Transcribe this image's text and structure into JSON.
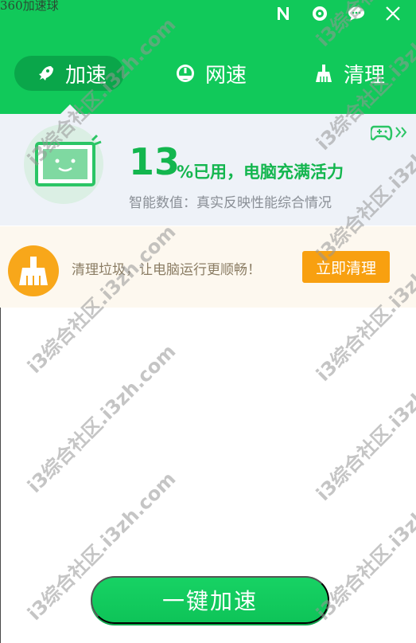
{
  "app": {
    "title": "360加速球"
  },
  "tabs": [
    {
      "label": "加速",
      "icon": "rocket-icon",
      "active": true
    },
    {
      "label": "网速",
      "icon": "speedometer-icon",
      "active": false
    },
    {
      "label": "清理",
      "icon": "broom-icon",
      "active": false
    }
  ],
  "status": {
    "percent": "13",
    "percent_text": "%已用，电脑充满活力",
    "subtitle": "智能数值：真实反映性能综合情况"
  },
  "clean": {
    "message": "清理垃圾，让电脑运行更顺畅！",
    "button": "立即清理"
  },
  "boost": {
    "button": "一键加速"
  },
  "watermarks": [
    "i3综合社区.i3zh.com",
    "i3综合社区.i3zh.com",
    "i3综合社区.i3zh.com",
    "i3综合社区.i3zh.com",
    "i3综合社区.i3zh.com",
    "i3综合社区.i3zh.com",
    "i3综合社区.i3zh.com",
    "i3综合社区.i3zh.com",
    "i3综合社区.i3zh.com",
    "i3综合社区.i3zh.com"
  ],
  "colors": {
    "green": "#11c95a",
    "orange": "#f8a71a",
    "text_green": "#13b64e"
  }
}
